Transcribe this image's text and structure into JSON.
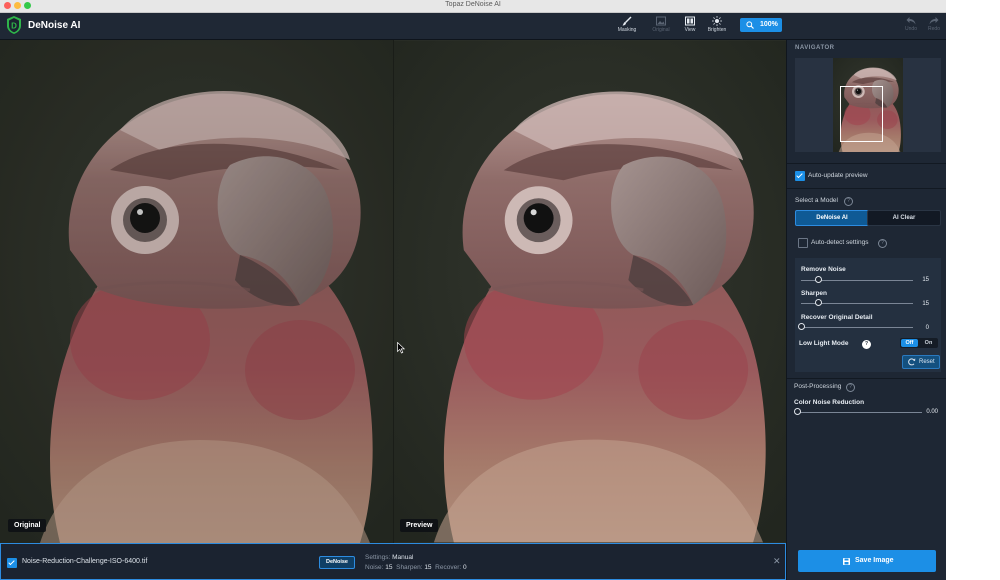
{
  "window": {
    "title": "Topaz DeNoise AI"
  },
  "app": {
    "name": "DeNoise AI"
  },
  "toolbar": {
    "masking": "Masking",
    "original": "Original",
    "view": "View",
    "brighten": "Brighten",
    "zoom": "100%",
    "undo": "Undo",
    "redo": "Redo"
  },
  "canvas": {
    "left_label": "Original",
    "right_label": "Preview"
  },
  "navigator": {
    "title": "NAVIGATOR"
  },
  "panel": {
    "auto_update": "Auto-update preview",
    "select_model": "Select a Model",
    "models": [
      "DeNoise AI",
      "AI Clear"
    ],
    "selected_model": "DeNoise AI",
    "auto_detect": "Auto-detect settings",
    "remove_noise": {
      "label": "Remove Noise",
      "value": "15",
      "fraction": 0.15
    },
    "sharpen": {
      "label": "Sharpen",
      "value": "15",
      "fraction": 0.15
    },
    "recover": {
      "label": "Recover Original Detail",
      "value": "0",
      "fraction": 0
    },
    "low_light": {
      "label": "Low Light Mode",
      "off": "Off",
      "on": "On",
      "state": "Off"
    },
    "reset": "Reset",
    "post_processing": "Post-Processing",
    "color_noise": {
      "label": "Color Noise Reduction",
      "value": "0.00",
      "fraction": 0
    },
    "save": "Save Image"
  },
  "file": {
    "name": "Noise-Reduction-Challenge-ISO-6400.tif",
    "badge": "DeNoise",
    "settings_label": "Settings:",
    "settings_value": "Manual",
    "noise_label": "Noise:",
    "noise_value": "15",
    "sharpen_label": "Sharpen:",
    "sharpen_value": "15",
    "recover_label": "Recover:",
    "recover_value": "0",
    "close": "✕"
  },
  "colors": {
    "accent": "#1c8fe6",
    "panel": "#1e2734",
    "background": "#2b2f28"
  }
}
